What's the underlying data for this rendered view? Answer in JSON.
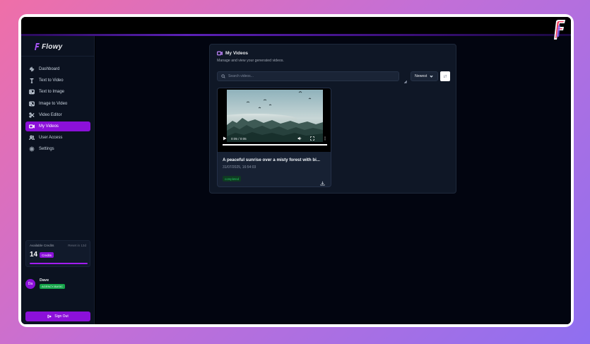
{
  "app": {
    "brand": "Flowy"
  },
  "sidebar": {
    "items": [
      {
        "label": "Dashboard",
        "icon": "dashboard-icon"
      },
      {
        "label": "Text to Video",
        "icon": "text-icon"
      },
      {
        "label": "Text to Image",
        "icon": "image-icon"
      },
      {
        "label": "Image to Video",
        "icon": "image-video-icon"
      },
      {
        "label": "Video Editor",
        "icon": "scissors-icon"
      },
      {
        "label": "My Videos",
        "icon": "video-icon",
        "active": true
      },
      {
        "label": "User Access",
        "icon": "users-icon"
      },
      {
        "label": "Settings",
        "icon": "gear-icon"
      }
    ],
    "credits": {
      "title": "Available Credits",
      "reset": "Reset in 13d",
      "count": "14",
      "badge": "Credits",
      "progress": 1.0
    },
    "user": {
      "initials": "Da",
      "name": "Dave",
      "plan": "AGENCY-BASIC"
    },
    "signout_label": "Sign Out"
  },
  "main": {
    "title": "My Videos",
    "subtitle": "Manage and view your generated videos.",
    "search_placeholder": "Search videos...",
    "sort_value": "Newest"
  },
  "videos": [
    {
      "title": "A peaceful sunrise over a misty forest with bi...",
      "date": "31/07/2025, 16:54:03",
      "status": "completed",
      "time_display": "0:05 / 0:05",
      "progress": 1.0
    }
  ],
  "colors": {
    "accent": "#8b10d9",
    "status_completed": "#22c55e"
  }
}
